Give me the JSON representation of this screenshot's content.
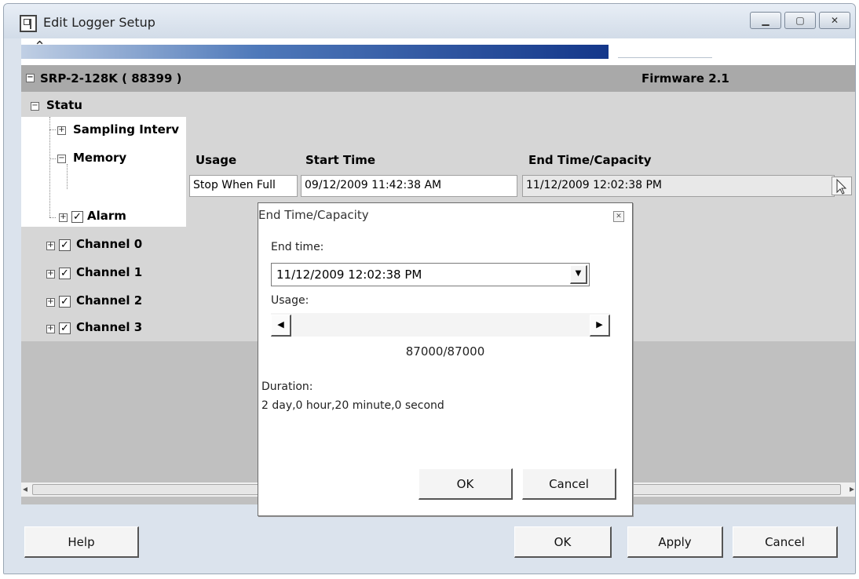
{
  "window": {
    "title": "Edit Logger Setup"
  },
  "device": {
    "name": "SRP-2-128K ( 88399 )",
    "firmware": "Firmware 2.1"
  },
  "tree": {
    "status": "Statu",
    "sampling": "Sampling Interv",
    "memory": "Memory",
    "alarm": "Alarm",
    "channels": [
      "Channel 0",
      "Channel 1",
      "Channel 2",
      "Channel 3"
    ]
  },
  "memory_table": {
    "headers": {
      "usage": "Usage",
      "start_time": "Start Time",
      "end_time": "End Time/Capacity"
    },
    "row": {
      "usage": "Stop When Full",
      "start_time": "09/12/2009 11:42:38 AM",
      "end_time": "11/12/2009 12:02:38 PM"
    }
  },
  "dialog": {
    "title": "End Time/Capacity",
    "end_time_label": "End time:",
    "end_time_value": "11/12/2009 12:02:38 PM",
    "usage_label": "Usage:",
    "usage_value": "87000/87000",
    "usage_fraction": 1.0,
    "duration_label": "Duration:",
    "duration_value": "2 day,0 hour,20 minute,0 second",
    "ok_label": "OK",
    "cancel_label": "Cancel"
  },
  "footer": {
    "help_label": "Help",
    "ok_label": "OK",
    "apply_label": "Apply",
    "cancel_label": "Cancel"
  },
  "icons": {
    "app": "logger-app-icon",
    "minimize": "minimize-icon",
    "maximize": "maximize-icon",
    "close": "close-icon"
  }
}
